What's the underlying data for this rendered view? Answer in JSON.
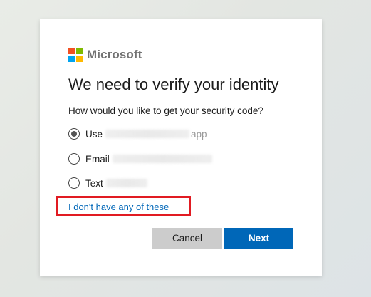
{
  "brand": {
    "name": "Microsoft",
    "logo_colors": [
      "#f25022",
      "#7fba00",
      "#00a4ef",
      "#ffb900"
    ]
  },
  "dialog": {
    "title": "We need to verify your identity",
    "question": "How would you like to get your security code?",
    "options": [
      {
        "label": "Use",
        "trailing": "app",
        "selected": true
      },
      {
        "label": "Email",
        "trailing": "",
        "selected": false
      },
      {
        "label": "Text",
        "trailing": "",
        "selected": false
      }
    ],
    "link_text": "I don't have any of these"
  },
  "buttons": {
    "cancel": "Cancel",
    "next": "Next"
  },
  "colors": {
    "accent": "#0067b8",
    "highlight": "#e11b22"
  }
}
